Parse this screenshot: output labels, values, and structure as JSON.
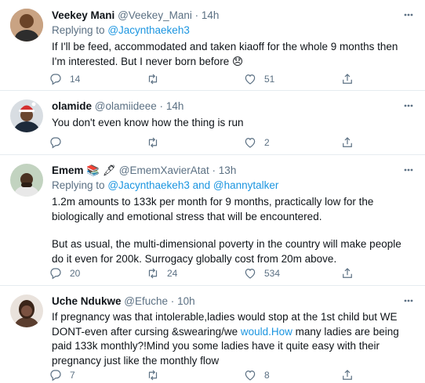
{
  "tweets": [
    {
      "name": "Veekey Mani",
      "handle": "@Veekey_Mani",
      "sep": "·",
      "time": "14h",
      "replying_prefix": "Replying to",
      "mentions": [
        "@Jacynthaekeh3"
      ],
      "text_lines": [
        "If I'll be feed, accommodated and taken kiaoff for the whole 9 months then",
        "I'm interested. But I never born before 😞"
      ],
      "replies": "14",
      "retweets": "",
      "likes": "51"
    },
    {
      "name": "olamide",
      "handle": "@olamiideee",
      "sep": "·",
      "time": "14h",
      "text": "You don't even know how the thing is run",
      "replies": "",
      "retweets": "",
      "likes": "2"
    },
    {
      "name": "Emem",
      "name_emoji": "📚 🖋",
      "handle": "@EmemXavierAtat",
      "sep": "·",
      "time": "13h",
      "replying_prefix": "Replying to",
      "mentions": [
        "@Jacynthaekeh3",
        "and",
        "@hannytalker"
      ],
      "para1": "1.2m amounts to 133k per month for 9 months, practically low for the biologically and emotional stress that will be encountered.",
      "para2": "But as usual, the multi-dimensional poverty in the country will make people do it even for 200k. Surrogacy globally cost from 20m above.",
      "replies": "20",
      "retweets": "24",
      "likes": "534"
    },
    {
      "name": "Uche Ndukwe",
      "handle": "@Efuche",
      "sep": "·",
      "time": "10h",
      "text_before_link": "If pregnancy was that intolerable,ladies would stop at the 1st child but WE DONT-even after cursing &swearing/we ",
      "link_text": "would.How",
      "text_after_link": " many ladies are being paid 133k monthly?!Mind you some ladies have it quite easy with their pregnancy just like the monthly flow",
      "replies": "7",
      "retweets": "",
      "likes": "8"
    }
  ],
  "colors": {
    "link": "#1b95e0",
    "muted": "#5b7083",
    "border": "#e6ecf0"
  }
}
